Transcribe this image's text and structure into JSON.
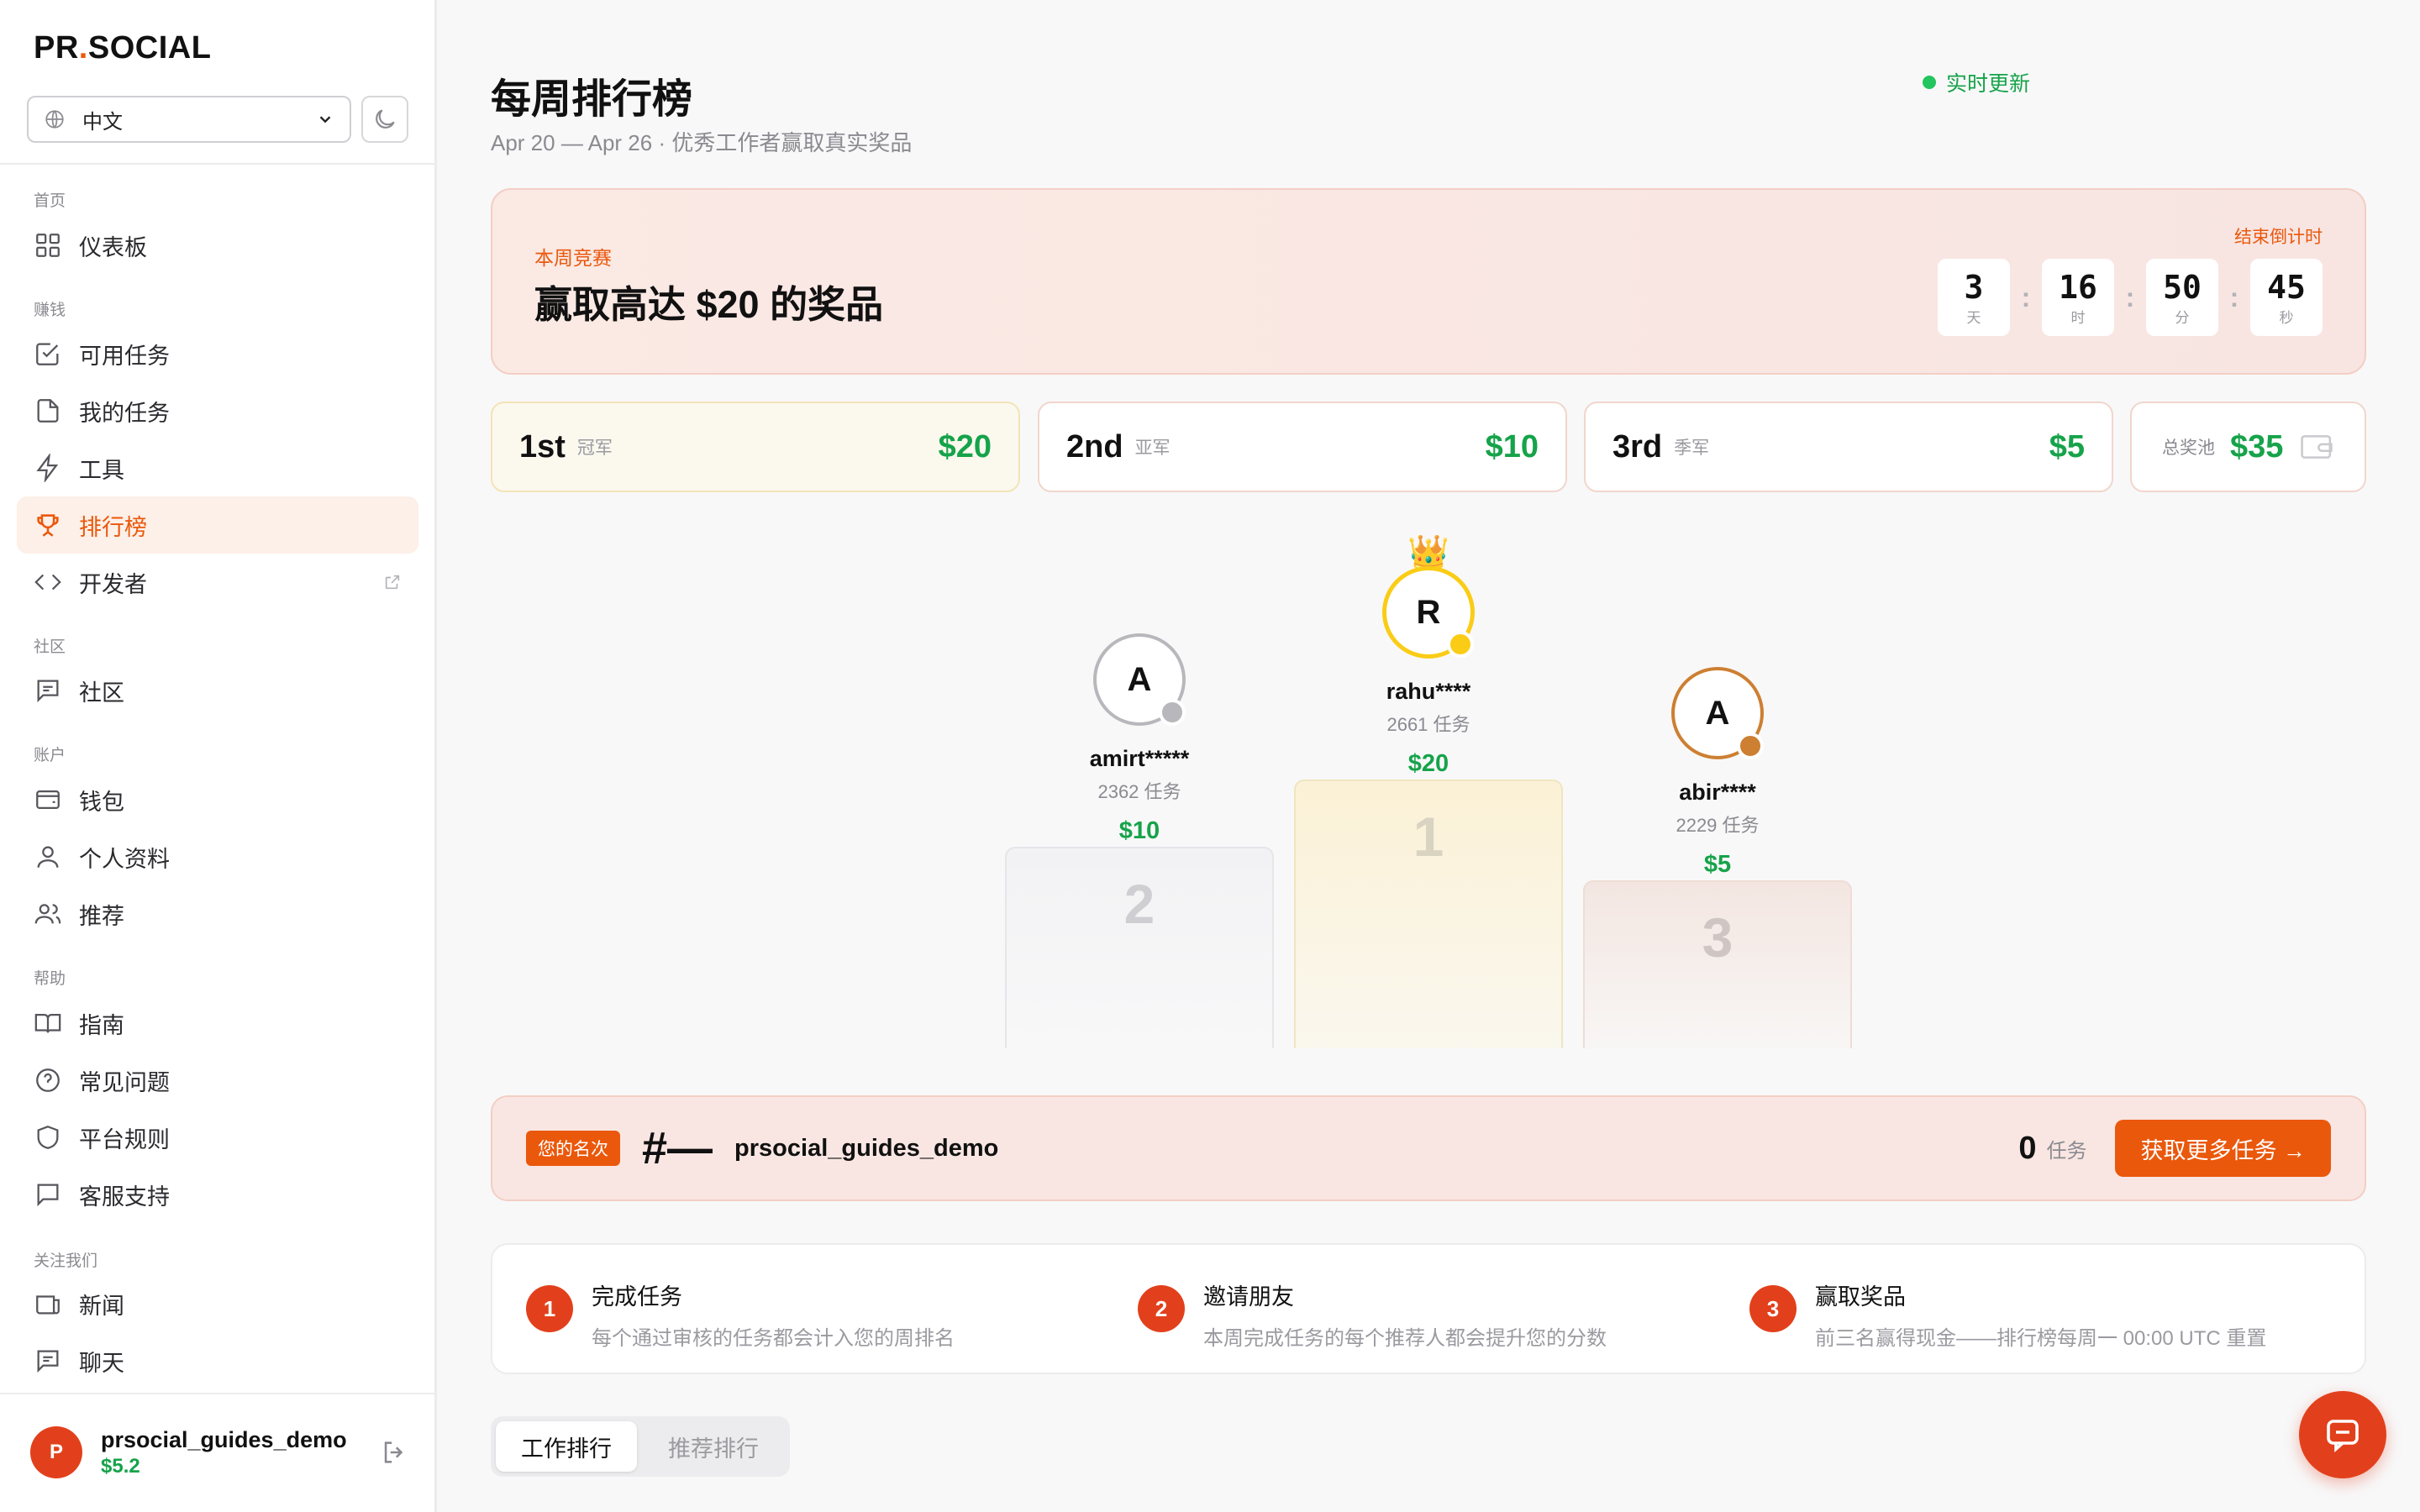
{
  "brand": {
    "logo_left": "PR",
    "logo_dot": ".",
    "logo_right": "SOCIAL"
  },
  "language": {
    "selected": "中文"
  },
  "sidebar": {
    "sections": {
      "home": "首页",
      "earn": "赚钱",
      "community": "社区",
      "account": "账户",
      "help": "帮助",
      "follow": "关注我们"
    },
    "items": {
      "dashboard": "仪表板",
      "available_tasks": "可用任务",
      "my_tasks": "我的任务",
      "tools": "工具",
      "leaderboard": "排行榜",
      "developer": "开发者",
      "community": "社区",
      "wallet": "钱包",
      "profile": "个人资料",
      "referral": "推荐",
      "guide": "指南",
      "faq": "常见问题",
      "rules": "平台规则",
      "support": "客服支持",
      "news": "新闻",
      "chat": "聊天"
    },
    "active_item": "leaderboard"
  },
  "user": {
    "initial": "P",
    "username": "prsocial_guides_demo",
    "balance": "$5.2"
  },
  "page": {
    "title": "每周排行榜",
    "subtitle": "Apr 20 — Apr 26 · 优秀工作者赢取真实奖品",
    "live_label": "实时更新"
  },
  "hero": {
    "kicker": "本周竞赛",
    "headline": "赢取高达 $20 的奖品",
    "countdown_label": "结束倒计时",
    "countdown": [
      {
        "value": "3",
        "unit": "天"
      },
      {
        "value": "16",
        "unit": "时"
      },
      {
        "value": "50",
        "unit": "分"
      },
      {
        "value": "45",
        "unit": "秒"
      }
    ]
  },
  "prizes": [
    {
      "rank": "1st",
      "sub": "冠军",
      "amount": "$20"
    },
    {
      "rank": "2nd",
      "sub": "亚军",
      "amount": "$10"
    },
    {
      "rank": "3rd",
      "sub": "季军",
      "amount": "$5"
    }
  ],
  "pool": {
    "label": "总奖池",
    "amount": "$35"
  },
  "podium": [
    {
      "place": "2",
      "initial": "A",
      "name": "amirt*****",
      "tasks": "2362 任务",
      "prize": "$10",
      "color": "#b8b8bc"
    },
    {
      "place": "1",
      "initial": "R",
      "name": "rahu****",
      "tasks": "2661 任务",
      "prize": "$20",
      "color": "#facc15"
    },
    {
      "place": "3",
      "initial": "A",
      "name": "abir****",
      "tasks": "2229 任务",
      "prize": "$5",
      "color": "#cd7f32"
    }
  ],
  "crown": "👑",
  "my_rank": {
    "tag": "您的名次",
    "position": "#—",
    "username": "prsocial_guides_demo",
    "tasks": "0",
    "tasks_unit": "任务",
    "cta": "获取更多任务 →"
  },
  "steps": [
    {
      "num": "1",
      "title": "完成任务",
      "desc": "每个通过审核的任务都会计入您的周排名"
    },
    {
      "num": "2",
      "title": "邀请朋友",
      "desc": "本周完成任务的每个推荐人都会提升您的分数"
    },
    {
      "num": "3",
      "title": "赢取奖品",
      "desc": "前三名赢得现金——排行榜每周一 00:00 UTC 重置"
    }
  ],
  "tabs": {
    "work": "工作排行",
    "referral": "推荐排行",
    "active": "work"
  },
  "colors": {
    "accent": "#ea580c",
    "success": "#16a34a",
    "gold": "#facc15",
    "silver": "#b8b8bc",
    "bronze": "#cd7f32"
  }
}
